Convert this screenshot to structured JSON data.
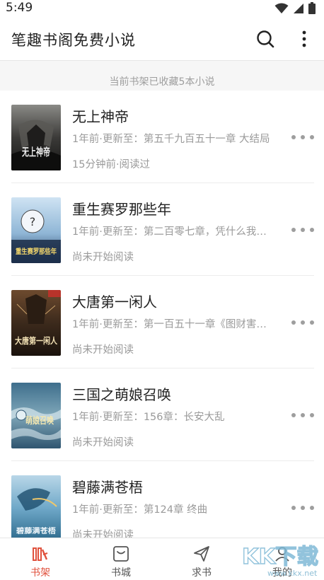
{
  "status_bar": {
    "time": "5:49"
  },
  "app_bar": {
    "title": "笔趣书阁免费小说"
  },
  "shelf": {
    "info_text": "当前书架已收藏5本小说"
  },
  "books": [
    {
      "title": "无上神帝",
      "update": "1年前·更新至：第五千九百五十一章 大结局",
      "status": "15分钟前·阅读过",
      "cover_text": "无上神帝"
    },
    {
      "title": "重生赛罗那些年",
      "update": "1年前·更新至：第二百零七章，凭什么我…",
      "status": "尚未开始阅读",
      "cover_text": "重生赛罗那些年"
    },
    {
      "title": "大唐第一闲人",
      "update": "1年前·更新至：第一百五十一章《图财害…",
      "status": "尚未开始阅读",
      "cover_text": "大唐第一闲人"
    },
    {
      "title": "三国之萌娘召唤",
      "update": "1年前·更新至：156章：长安大乱",
      "status": "尚未开始阅读",
      "cover_text": "萌娘召唤"
    },
    {
      "title": "碧藤满苍梧",
      "update": "1年前·更新至：第124章 终曲",
      "status": "尚未开始阅读",
      "cover_text": "碧藤满苍梧"
    }
  ],
  "tabs": [
    {
      "label": "书架",
      "icon": "bookshelf-icon",
      "active": true
    },
    {
      "label": "书城",
      "icon": "bookstore-icon",
      "active": false
    },
    {
      "label": "求书",
      "icon": "paper-plane-icon",
      "active": false
    },
    {
      "label": "我的",
      "icon": "user-icon",
      "active": false
    }
  ],
  "watermark": {
    "text": "www.kkx.net",
    "logo_text": "KK下载"
  },
  "colors": {
    "accent": "#e0513d",
    "text_primary": "#222222",
    "text_secondary": "#9a9a9a",
    "divider": "#ececec",
    "info_background": "#f6f6f6"
  }
}
